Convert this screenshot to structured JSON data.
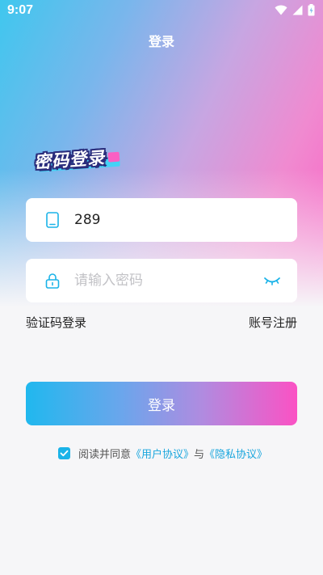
{
  "status_bar": {
    "time": "9:07"
  },
  "header": {
    "title": "登录"
  },
  "logo": {
    "text": "密码登录"
  },
  "form": {
    "phone_value": "289",
    "password_placeholder": "请输入密码"
  },
  "links": {
    "sms_login": "验证码登录",
    "register": "账号注册"
  },
  "login_button": {
    "label": "登录"
  },
  "agreement": {
    "prefix": "阅读并同意",
    "user_agreement": "《用户协议》",
    "connector": "与",
    "privacy_policy": "《隐私协议》",
    "checked": true
  },
  "colors": {
    "accent_blue": "#1ab3e8",
    "accent_pink": "#fb52c4",
    "link": "#1aa6dd"
  },
  "icons": {
    "phone": "phone-icon",
    "lock": "lock-icon",
    "eye": "eye-closed-icon",
    "wifi": "wifi-icon",
    "signal": "signal-icon",
    "battery": "battery-icon",
    "check": "check-icon"
  }
}
